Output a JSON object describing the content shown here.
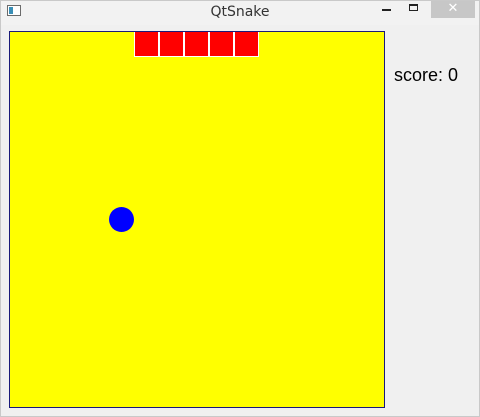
{
  "window": {
    "title": "QtSnake",
    "close_glyph": "✕"
  },
  "game": {
    "board_color": "#ffff00",
    "snake_color": "#ff0000",
    "food_color": "#0000ff",
    "snake_length": 5,
    "score_label": "score: 0"
  }
}
